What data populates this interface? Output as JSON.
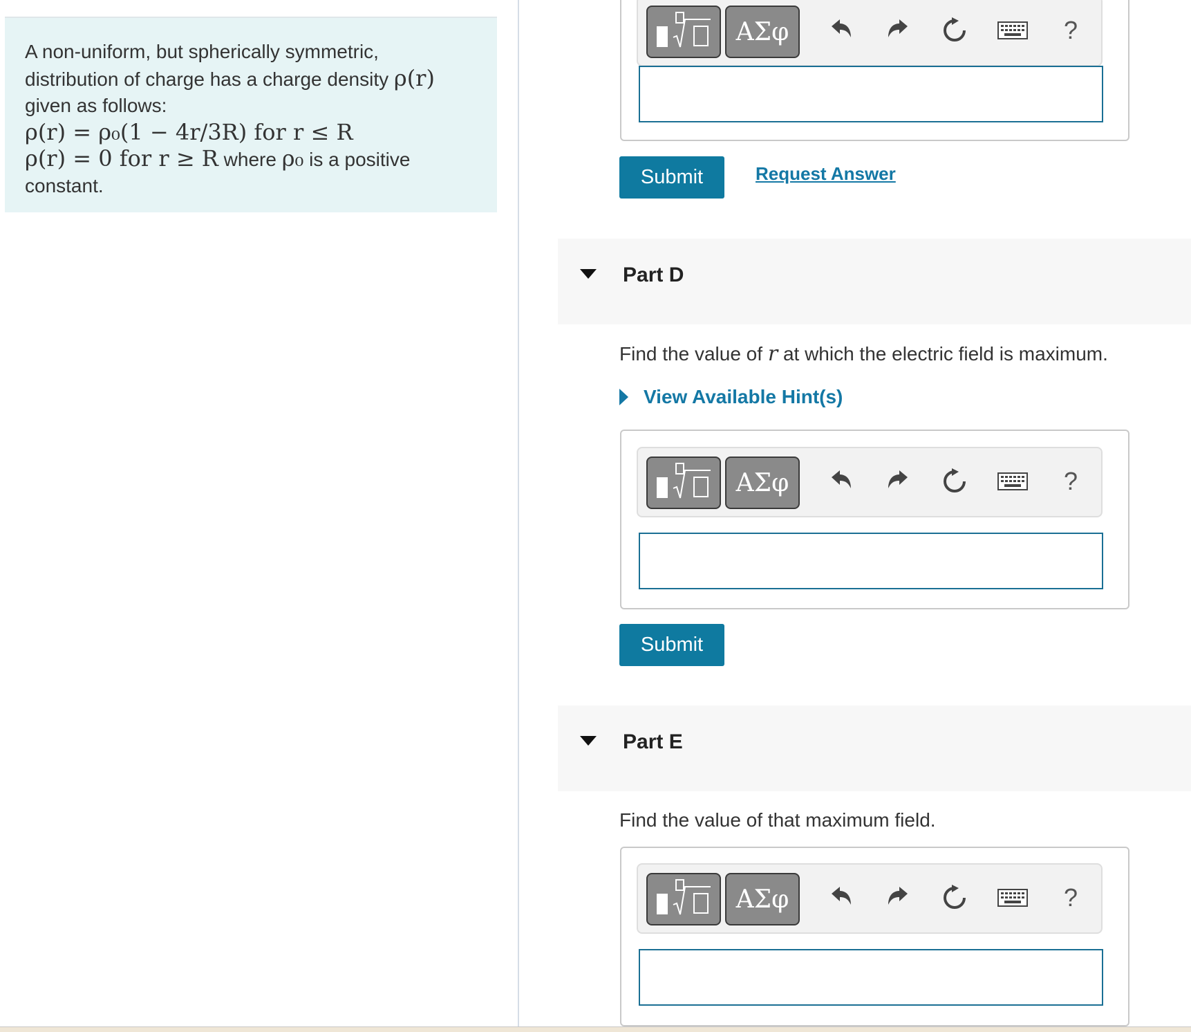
{
  "problem": {
    "line1": "A non-uniform, but spherically symmetric,",
    "line2": "distribution of charge has a charge density",
    "line2_math": "ρ(r)",
    "line3": "given as follows:",
    "eq1": "ρ(r) = ρ₀(1 − 4r/3R) for r ≤ R",
    "eq2_math": "ρ(r) = 0 for r ≥ R",
    "eq2_where": "where",
    "eq2_rho0": "ρ₀",
    "eq2_tail": "is a positive",
    "line6": "constant."
  },
  "toolbar": {
    "template_label": "",
    "greek_label": "ΑΣφ",
    "help_label": "?"
  },
  "part_c": {
    "submit_label": "Submit",
    "request_answer_label": "Request Answer"
  },
  "part_d": {
    "title": "Part D",
    "question_pre": "Find the value of",
    "question_var": "r",
    "question_post": "at which the electric field is maximum.",
    "hint_label": "View Available Hint(s)",
    "submit_label": "Submit"
  },
  "part_e": {
    "title": "Part E",
    "question": "Find the value of that maximum field."
  },
  "colors": {
    "accent": "#0f7aa0",
    "link": "#1478a5",
    "problem_bg": "#e6f4f5"
  }
}
